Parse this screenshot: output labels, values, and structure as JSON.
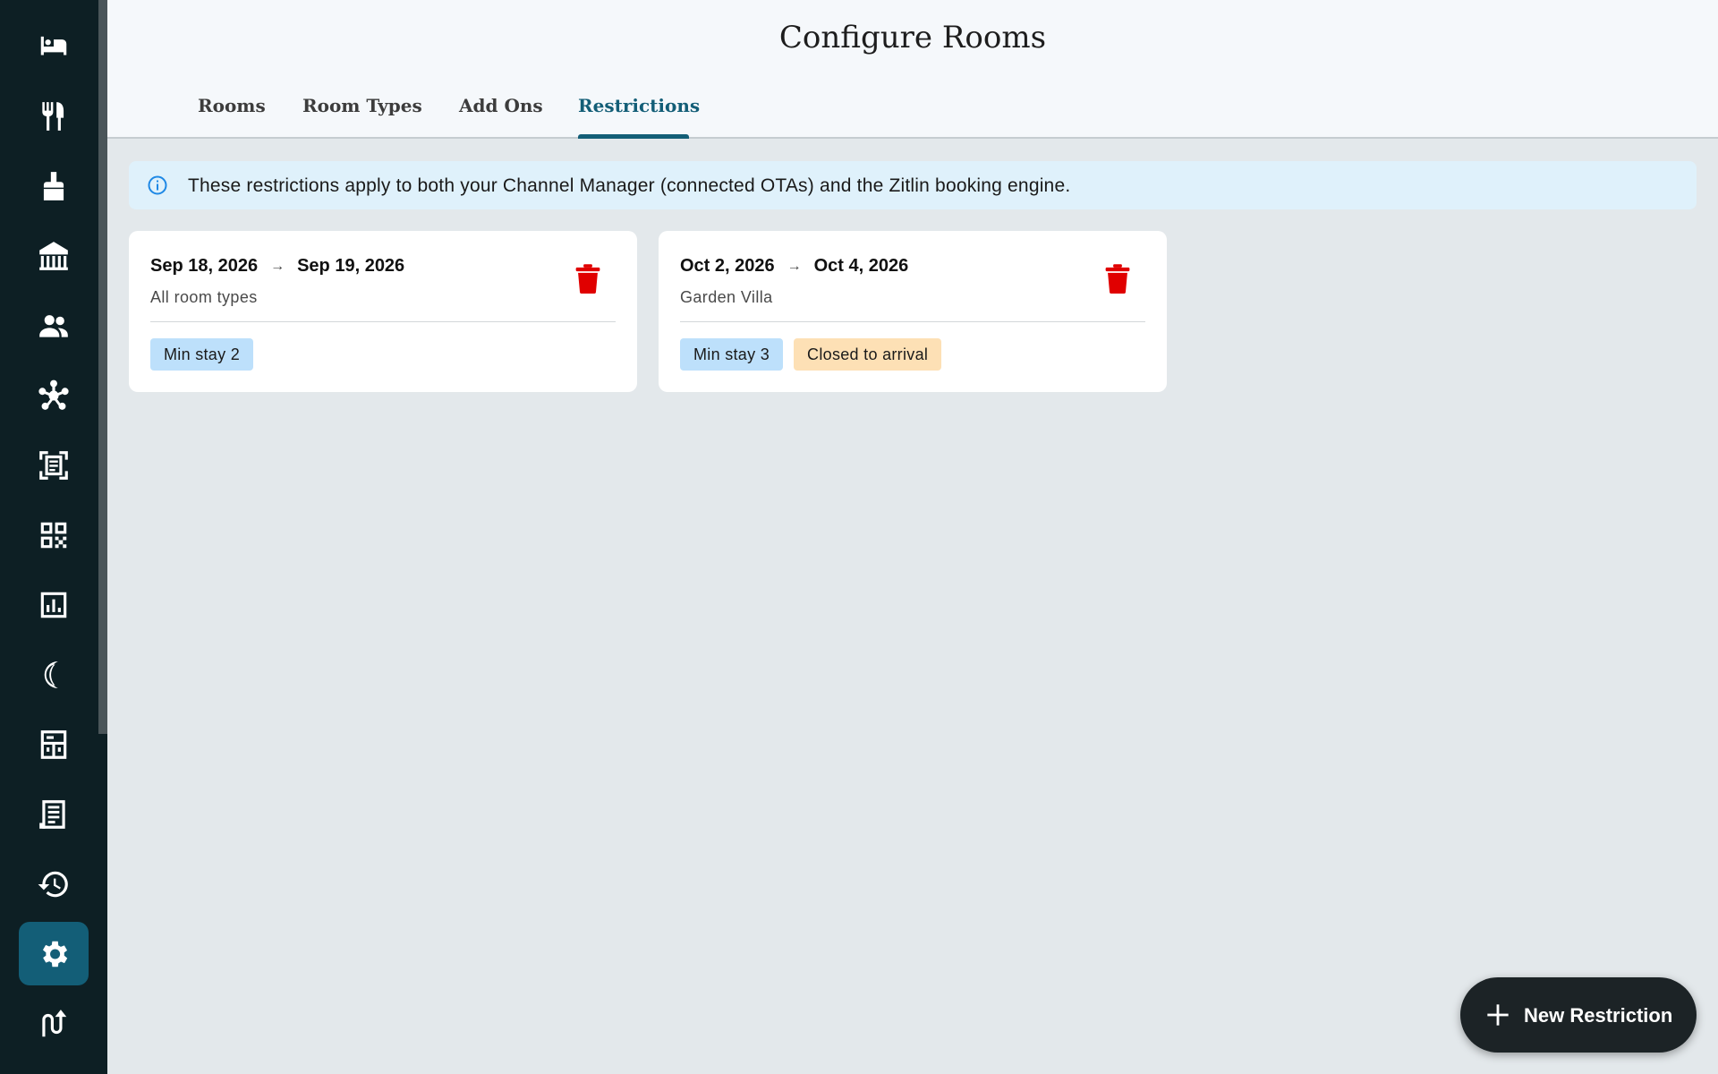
{
  "header": {
    "title": "Configure Rooms",
    "tabs": [
      {
        "label": "Rooms",
        "active": false
      },
      {
        "label": "Room Types",
        "active": false
      },
      {
        "label": "Add Ons",
        "active": false
      },
      {
        "label": "Restrictions",
        "active": true
      }
    ]
  },
  "sidebar": {
    "items": [
      {
        "icon": "bed-icon",
        "active": false
      },
      {
        "icon": "restaurant-icon",
        "active": false
      },
      {
        "icon": "housekeeping-icon",
        "active": false
      },
      {
        "icon": "building-icon",
        "active": false
      },
      {
        "icon": "people-icon",
        "active": false
      },
      {
        "icon": "network-icon",
        "active": false
      },
      {
        "icon": "receipt-scan-icon",
        "active": false
      },
      {
        "icon": "qr-code-icon",
        "active": false
      },
      {
        "icon": "report-chart-icon",
        "active": false
      },
      {
        "icon": "night-audit-icon",
        "active": false
      },
      {
        "icon": "room-grid-icon",
        "active": false
      },
      {
        "icon": "invoice-icon",
        "active": false
      },
      {
        "icon": "history-icon",
        "active": false
      },
      {
        "icon": "settings-icon",
        "active": true
      },
      {
        "icon": "channel-sync-icon",
        "active": false
      }
    ]
  },
  "banner": {
    "icon": "info-icon",
    "text": "These restrictions apply to both your Channel Manager (connected OTAs) and the Zitlin booking engine."
  },
  "restrictions": [
    {
      "start": "Sep 18, 2026",
      "end": "Sep 19, 2026",
      "arrow": "→",
      "room": "All room types",
      "chips": [
        {
          "label": "Min stay 2",
          "tone": "blue"
        }
      ]
    },
    {
      "start": "Oct 2, 2026",
      "end": "Oct 4, 2026",
      "arrow": "→",
      "room": "Garden Villa",
      "chips": [
        {
          "label": "Min stay 3",
          "tone": "blue"
        },
        {
          "label": "Closed to arrival",
          "tone": "orange"
        }
      ]
    }
  ],
  "fab": {
    "label": "New Restriction",
    "icon": "plus-icon"
  },
  "colors": {
    "sidebar_bg": "#0d1f24",
    "accent": "#135e77",
    "delete_red": "#e00000",
    "chip_blue": "#bde0fb",
    "chip_orange": "#fde0b5"
  }
}
